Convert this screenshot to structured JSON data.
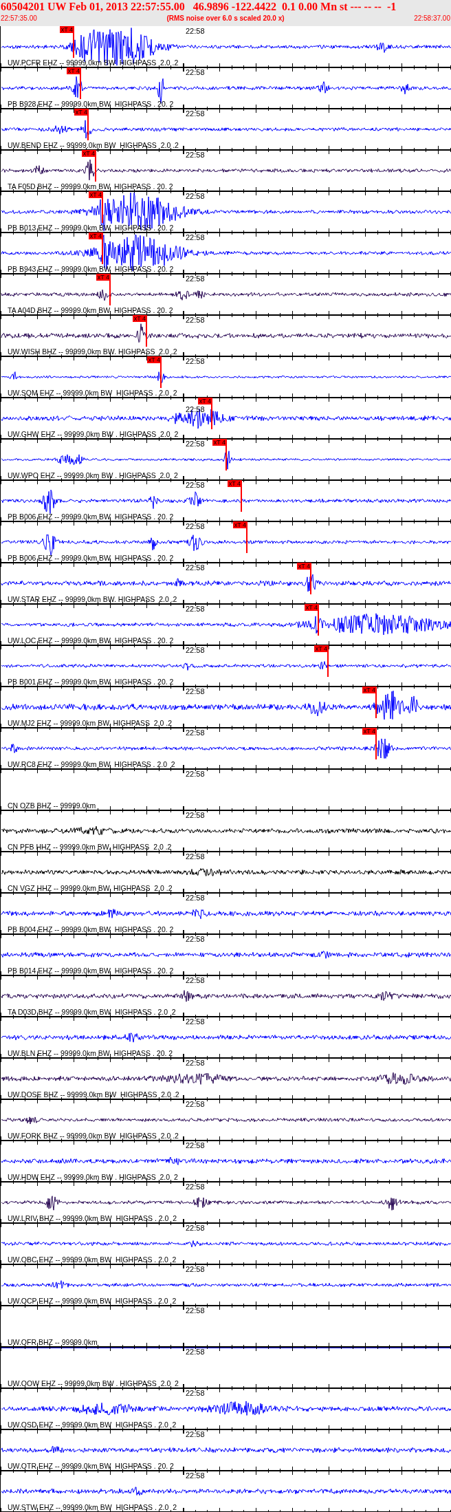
{
  "header": {
    "title": "60504201 UW Feb 01, 2013 22:57:55.00   46.9896 -122.4422  0.1 0.00 Mn st --- -- --  -1",
    "start_time": "22:57:35.00",
    "note": "(RMS noise over 6.0 s scaled 20.0 x)",
    "end_time": "22:58:37.00"
  },
  "traces": [
    {
      "kind": "waveform",
      "time": "22:58",
      "label": "UW.PCFR EHZ -- 99999.0km BW  HIGHPASS  2.0 .2",
      "color": "#0000ff",
      "pick": {
        "label": "xT 4"
      }
    },
    {
      "kind": "waveform",
      "time": "22:58",
      "label": "PB B928 EHZ -- 99999.0km BW  HIGHPASS . 20. 2",
      "color": "#0000ff",
      "pick": {
        "label": "xT 4"
      }
    },
    {
      "kind": "waveform",
      "time": "22:58",
      "label": "UW.BEND EHZ -- 99999.0km BW  HIGHPASS  2.0 .2",
      "color": "#0000ff",
      "pick": {
        "label": "xT 4"
      }
    },
    {
      "kind": "waveform",
      "time": "22:58",
      "label": "TA F05D BHZ -- 99999.0km BW  HIGHPASS . 20. 2",
      "color": "#2a0a55",
      "pick": {
        "label": "xT 4"
      }
    },
    {
      "kind": "waveform",
      "time": "22:58",
      "label": "PB B013 EHZ -- 99999.0km BW  HIGHPASS . 20. 2",
      "color": "#0000ff",
      "pick": {
        "label": "xT 4"
      }
    },
    {
      "kind": "waveform",
      "time": "22:58",
      "label": "PB B943 EHZ -- 99999.0km BW  HIGHPASS . 20. 2",
      "color": "#0000ff",
      "pick": {
        "label": "xT 4"
      }
    },
    {
      "kind": "waveform",
      "time": "22:58",
      "label": "TA A04D BHZ -- 99999.0km BW  HIGHPASS . 20. 2",
      "color": "#2a0a55",
      "pick": {
        "label": "xT 4"
      }
    },
    {
      "kind": "waveform",
      "time": "22:58",
      "label": "UW.WISH BHZ -- 99999.0km BW. HIGHPASS  2.0 .2",
      "color": "#2a0a55",
      "pick": {
        "label": "xT 4"
      }
    },
    {
      "kind": "waveform",
      "time": "22:58",
      "label": "UW.SQM EHZ -- 99999.0km BW  HIGHPASS . 2.0  2",
      "color": "#0000ff",
      "pick": {
        "label": "xT 4"
      }
    },
    {
      "kind": "waveform",
      "time": "22:58",
      "label": "UW.GHW EHZ -- 99999.0km BW . HIGHPASS  2.0  2",
      "color": "#0000ff",
      "pick": {
        "label": "xT 4"
      }
    },
    {
      "kind": "waveform",
      "time": "22:58",
      "label": "UW.WPO EHZ -- 99999.0km BW . HIGHPASS  2.0  2",
      "color": "#0000ff",
      "pick": {
        "label": "xT 4"
      }
    },
    {
      "kind": "waveform",
      "time": "22:58",
      "label": "PB B006 EHZ -- 99999.0km BW  HIGHPASS . 20. 2",
      "color": "#0000ff",
      "pick": {
        "label": "xT 4"
      }
    },
    {
      "kind": "waveform",
      "time": "22:58",
      "label": "PB B006 EHZ -- 99999.0km BW  HIGHPASS . 20. 2",
      "color": "#0000ff",
      "pick": {
        "label": "xT 4"
      }
    },
    {
      "kind": "waveform",
      "time": "22:58",
      "label": "UW.STAR EHZ -- 99999.0km BW. HIGHPASS  2.0 .2",
      "color": "#0000ff",
      "pick": {
        "label": "xT 4"
      }
    },
    {
      "kind": "waveform",
      "time": "22:58",
      "label": "UW.LOC EHZ -- 99999.0km BW  HIGHPASS . 20. 2",
      "color": "#0000ff",
      "pick": {
        "label": "xT 4"
      }
    },
    {
      "kind": "waveform",
      "time": "22:58",
      "label": "PB B001 EHZ -- 99999.0km BW  HIGHPASS . 20. 2",
      "color": "#0000ff",
      "pick": {
        "label": "xT 4"
      }
    },
    {
      "kind": "waveform",
      "time": "22:58",
      "label": "UW.MJ2 EHZ -- 99999.0km BW. HIGHPASS  2.0 .2",
      "color": "#0000ff",
      "pick": {
        "label": "xT 4"
      }
    },
    {
      "kind": "waveform",
      "time": "22:58",
      "label": "UW.RC8 EHZ -- 99999.0km BW  HIGHPASS . 2.0  2",
      "color": "#0000ff",
      "pick": {
        "label": "xT 4"
      }
    },
    {
      "kind": "none",
      "time": "22:58",
      "label": "CN OZB BHZ -- 99999.0km"
    },
    {
      "kind": "waveform",
      "time": "22:58",
      "label": "CN PFB HHZ -- 99999.0km BW. HIGHPASS  2.0 .2",
      "color": "#000000"
    },
    {
      "kind": "waveform",
      "time": "22:58",
      "label": "CN VGZ HHZ -- 99999.0km BW. HIGHPASS  2.0 .2",
      "color": "#000000"
    },
    {
      "kind": "waveform",
      "time": "22:58",
      "label": "PB B004 EHZ -- 99999.0km BW  HIGHPASS . 20. 2",
      "color": "#0000ff"
    },
    {
      "kind": "waveform",
      "time": "22:58",
      "label": "PB B014 EHZ -- 99999.0km BW  HIGHPASS . 20. 2",
      "color": "#0000ff"
    },
    {
      "kind": "waveform",
      "time": "22:58",
      "label": "TA D03D BHZ -- 99999.0km BW  HIGHPASS . 2.0  2",
      "color": "#2a0a55"
    },
    {
      "kind": "waveform",
      "time": "22:58",
      "label": "UW.BLN EHZ -- 99999.0km BW  HIGHPASS . 20. 2",
      "color": "#0000ff"
    },
    {
      "kind": "waveform",
      "time": "22:58",
      "label": "UW.DOSE BHZ -- 99999.0km BW  HIGHPASS  2.0 .2",
      "color": "#2a0a55"
    },
    {
      "kind": "waveform",
      "time": "22:58",
      "label": "UW.FORK BHZ -- 99999.0km BW  HIGHPASS  2.0 .2",
      "color": "#2a0a55"
    },
    {
      "kind": "waveform",
      "time": "22:58",
      "label": "UW.HDW EHZ -- 99999.0km BW . HIGHPASS  2.0  2",
      "color": "#0000ff"
    },
    {
      "kind": "waveform",
      "time": "22:58",
      "label": "UW.LRIV BHZ -- 99999.0km BW  HIGHPASS . 2.0  2",
      "color": "#2a0a55"
    },
    {
      "kind": "waveform",
      "time": "22:58",
      "label": "UW.OBC EHZ -- 99999.0km BW  HIGHPASS . 2.0  2",
      "color": "#0000ff"
    },
    {
      "kind": "waveform",
      "time": "22:58",
      "label": "UW.OCP EHZ -- 99999.0km BW  HIGHPASS . 2.0  2",
      "color": "#0000ff"
    },
    {
      "kind": "flat",
      "time": "22:58",
      "label": "UW.OFR BHZ -- 99999.0km",
      "color": "#0000ff"
    },
    {
      "kind": "none",
      "time": "22:58",
      "label": "UW.OOW EHZ -- 99999.0km BW . HIGHPASS  2.0  2"
    },
    {
      "kind": "waveform",
      "time": "22:58",
      "label": "UW.OSD EHZ -- 99999.0km BW  HIGHPASS . 2.0  2",
      "color": "#0000ff"
    },
    {
      "kind": "waveform",
      "time": "22:58",
      "label": "UW.OTR EHZ -- 99999.0km BW  HIGHPASS . 20. 2",
      "color": "#0000ff"
    },
    {
      "kind": "waveform",
      "time": "22:58",
      "label": "UW.STW EHZ -- 99999.0km BW  HIGHPASS . 2.0  2",
      "color": "#0000ff"
    }
  ]
}
